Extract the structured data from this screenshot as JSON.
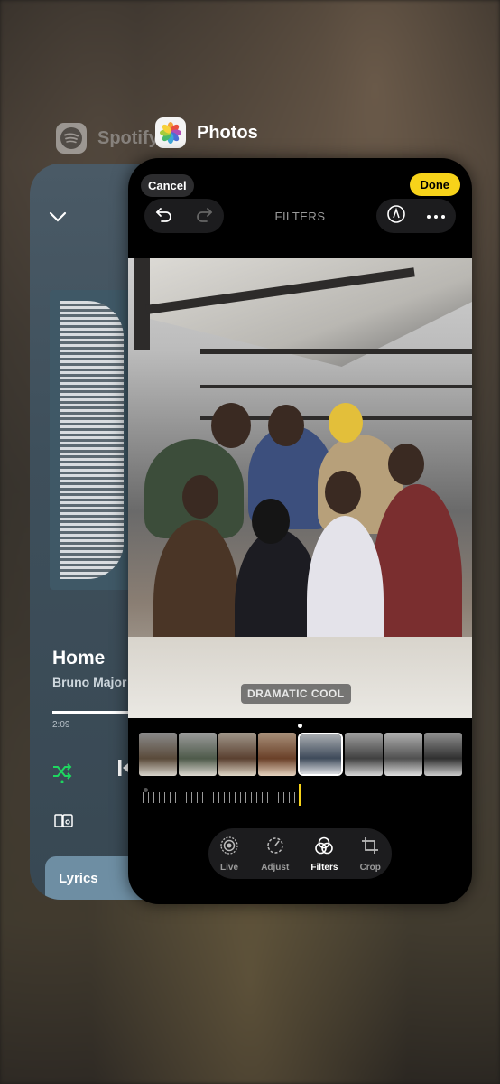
{
  "spotify": {
    "app_name": "Spotify",
    "song_title": "Home",
    "artist": "Bruno Major",
    "elapsed": "2:09",
    "progress": 0.55,
    "lyrics_label": "Lyrics",
    "accent": "#1ed760"
  },
  "photos": {
    "app_name": "Photos",
    "cancel_label": "Cancel",
    "done_label": "Done",
    "screen_title": "FILTERS",
    "filter_name": "DRAMATIC COOL",
    "tools": [
      {
        "label": "Live",
        "icon": "live-icon"
      },
      {
        "label": "Adjust",
        "icon": "adjust-icon"
      },
      {
        "label": "Filters",
        "icon": "filters-icon",
        "active": true
      },
      {
        "label": "Crop",
        "icon": "crop-icon"
      }
    ],
    "accent": "#f7d31a"
  }
}
